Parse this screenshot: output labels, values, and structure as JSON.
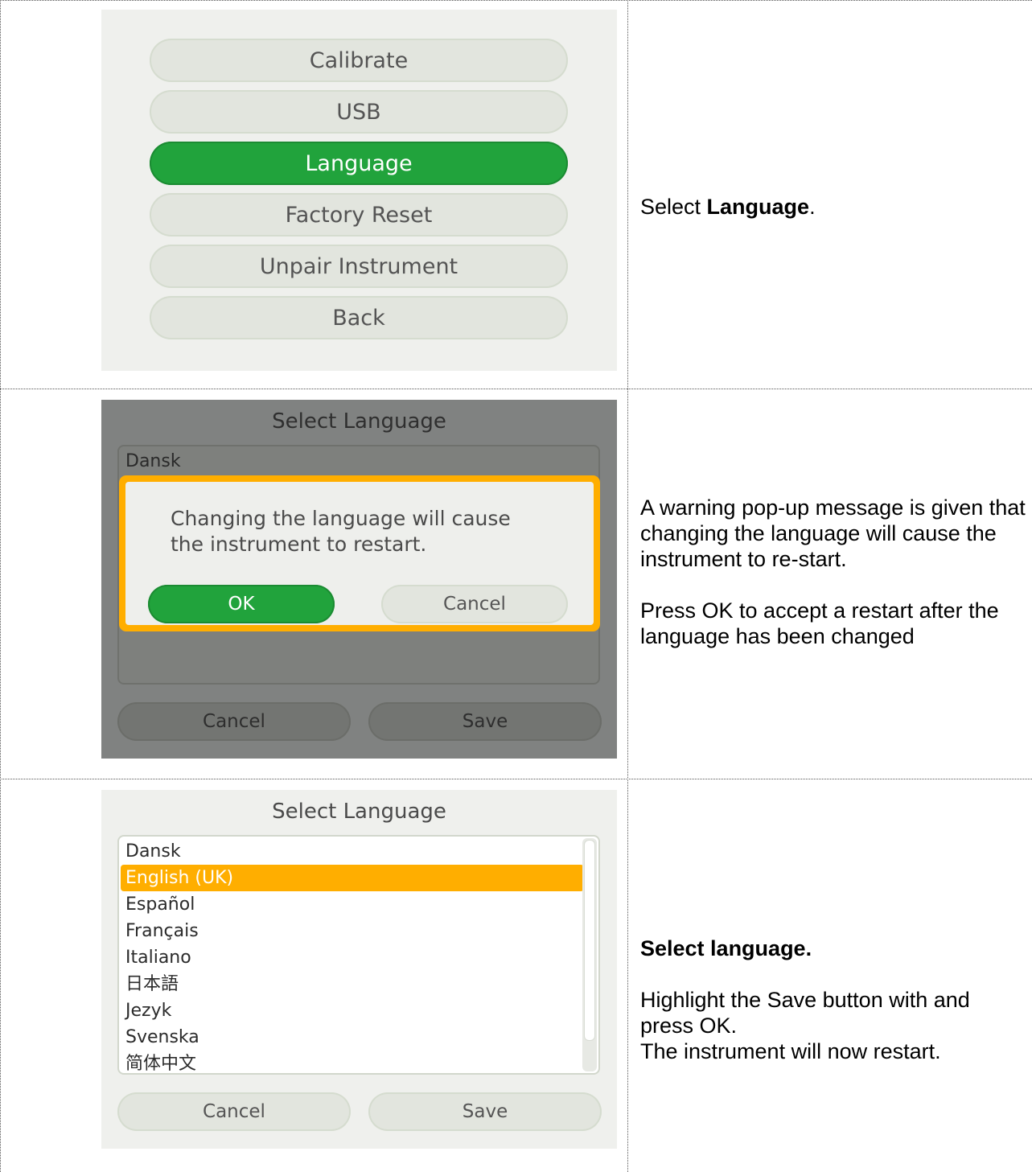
{
  "row1": {
    "menu": [
      "Calibrate",
      "USB",
      "Language",
      "Factory Reset",
      "Unpair Instrument",
      "Back"
    ],
    "active_index": 2,
    "instruction_prefix": "Select ",
    "instruction_bold": "Language",
    "instruction_suffix": "."
  },
  "row2": {
    "screen_title": "Select Language",
    "list_first_item": "Dansk",
    "dialog_message": "Changing the language will cause the instrument to restart.",
    "ok_label": "OK",
    "dialog_cancel_label": "Cancel",
    "cancel_label": "Cancel",
    "save_label": "Save",
    "para1": "A warning pop-up message is given that changing the language will cause the instrument to re-start.",
    "para2": "Press OK to accept a restart after the language has been changed"
  },
  "row3": {
    "screen_title": "Select Language",
    "languages": [
      "Dansk",
      "English (UK)",
      "Español",
      "Français",
      "Italiano",
      "日本語",
      "Jezyk",
      "Svenska",
      "简体中文"
    ],
    "selected_index": 1,
    "cancel_label": "Cancel",
    "save_label": "Save",
    "heading": "Select language.",
    "para1": "Highlight the Save button with and press OK.",
    "para2": "The instrument will now restart."
  },
  "colors": {
    "accent_green": "#21a33c",
    "highlight_orange": "#ffae00",
    "button_grey": "#e2e5de"
  }
}
